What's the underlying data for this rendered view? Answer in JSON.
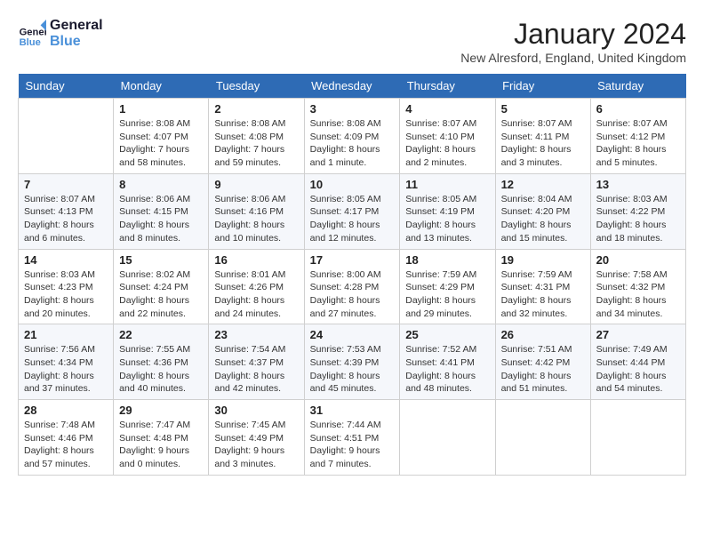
{
  "logo": {
    "line1": "General",
    "line2": "Blue"
  },
  "title": "January 2024",
  "location": "New Alresford, England, United Kingdom",
  "days_header": [
    "Sunday",
    "Monday",
    "Tuesday",
    "Wednesday",
    "Thursday",
    "Friday",
    "Saturday"
  ],
  "weeks": [
    [
      {
        "day": "",
        "info": ""
      },
      {
        "day": "1",
        "info": "Sunrise: 8:08 AM\nSunset: 4:07 PM\nDaylight: 7 hours\nand 58 minutes."
      },
      {
        "day": "2",
        "info": "Sunrise: 8:08 AM\nSunset: 4:08 PM\nDaylight: 7 hours\nand 59 minutes."
      },
      {
        "day": "3",
        "info": "Sunrise: 8:08 AM\nSunset: 4:09 PM\nDaylight: 8 hours\nand 1 minute."
      },
      {
        "day": "4",
        "info": "Sunrise: 8:07 AM\nSunset: 4:10 PM\nDaylight: 8 hours\nand 2 minutes."
      },
      {
        "day": "5",
        "info": "Sunrise: 8:07 AM\nSunset: 4:11 PM\nDaylight: 8 hours\nand 3 minutes."
      },
      {
        "day": "6",
        "info": "Sunrise: 8:07 AM\nSunset: 4:12 PM\nDaylight: 8 hours\nand 5 minutes."
      }
    ],
    [
      {
        "day": "7",
        "info": "Sunrise: 8:07 AM\nSunset: 4:13 PM\nDaylight: 8 hours\nand 6 minutes."
      },
      {
        "day": "8",
        "info": "Sunrise: 8:06 AM\nSunset: 4:15 PM\nDaylight: 8 hours\nand 8 minutes."
      },
      {
        "day": "9",
        "info": "Sunrise: 8:06 AM\nSunset: 4:16 PM\nDaylight: 8 hours\nand 10 minutes."
      },
      {
        "day": "10",
        "info": "Sunrise: 8:05 AM\nSunset: 4:17 PM\nDaylight: 8 hours\nand 12 minutes."
      },
      {
        "day": "11",
        "info": "Sunrise: 8:05 AM\nSunset: 4:19 PM\nDaylight: 8 hours\nand 13 minutes."
      },
      {
        "day": "12",
        "info": "Sunrise: 8:04 AM\nSunset: 4:20 PM\nDaylight: 8 hours\nand 15 minutes."
      },
      {
        "day": "13",
        "info": "Sunrise: 8:03 AM\nSunset: 4:22 PM\nDaylight: 8 hours\nand 18 minutes."
      }
    ],
    [
      {
        "day": "14",
        "info": "Sunrise: 8:03 AM\nSunset: 4:23 PM\nDaylight: 8 hours\nand 20 minutes."
      },
      {
        "day": "15",
        "info": "Sunrise: 8:02 AM\nSunset: 4:24 PM\nDaylight: 8 hours\nand 22 minutes."
      },
      {
        "day": "16",
        "info": "Sunrise: 8:01 AM\nSunset: 4:26 PM\nDaylight: 8 hours\nand 24 minutes."
      },
      {
        "day": "17",
        "info": "Sunrise: 8:00 AM\nSunset: 4:28 PM\nDaylight: 8 hours\nand 27 minutes."
      },
      {
        "day": "18",
        "info": "Sunrise: 7:59 AM\nSunset: 4:29 PM\nDaylight: 8 hours\nand 29 minutes."
      },
      {
        "day": "19",
        "info": "Sunrise: 7:59 AM\nSunset: 4:31 PM\nDaylight: 8 hours\nand 32 minutes."
      },
      {
        "day": "20",
        "info": "Sunrise: 7:58 AM\nSunset: 4:32 PM\nDaylight: 8 hours\nand 34 minutes."
      }
    ],
    [
      {
        "day": "21",
        "info": "Sunrise: 7:56 AM\nSunset: 4:34 PM\nDaylight: 8 hours\nand 37 minutes."
      },
      {
        "day": "22",
        "info": "Sunrise: 7:55 AM\nSunset: 4:36 PM\nDaylight: 8 hours\nand 40 minutes."
      },
      {
        "day": "23",
        "info": "Sunrise: 7:54 AM\nSunset: 4:37 PM\nDaylight: 8 hours\nand 42 minutes."
      },
      {
        "day": "24",
        "info": "Sunrise: 7:53 AM\nSunset: 4:39 PM\nDaylight: 8 hours\nand 45 minutes."
      },
      {
        "day": "25",
        "info": "Sunrise: 7:52 AM\nSunset: 4:41 PM\nDaylight: 8 hours\nand 48 minutes."
      },
      {
        "day": "26",
        "info": "Sunrise: 7:51 AM\nSunset: 4:42 PM\nDaylight: 8 hours\nand 51 minutes."
      },
      {
        "day": "27",
        "info": "Sunrise: 7:49 AM\nSunset: 4:44 PM\nDaylight: 8 hours\nand 54 minutes."
      }
    ],
    [
      {
        "day": "28",
        "info": "Sunrise: 7:48 AM\nSunset: 4:46 PM\nDaylight: 8 hours\nand 57 minutes."
      },
      {
        "day": "29",
        "info": "Sunrise: 7:47 AM\nSunset: 4:48 PM\nDaylight: 9 hours\nand 0 minutes."
      },
      {
        "day": "30",
        "info": "Sunrise: 7:45 AM\nSunset: 4:49 PM\nDaylight: 9 hours\nand 3 minutes."
      },
      {
        "day": "31",
        "info": "Sunrise: 7:44 AM\nSunset: 4:51 PM\nDaylight: 9 hours\nand 7 minutes."
      },
      {
        "day": "",
        "info": ""
      },
      {
        "day": "",
        "info": ""
      },
      {
        "day": "",
        "info": ""
      }
    ]
  ]
}
